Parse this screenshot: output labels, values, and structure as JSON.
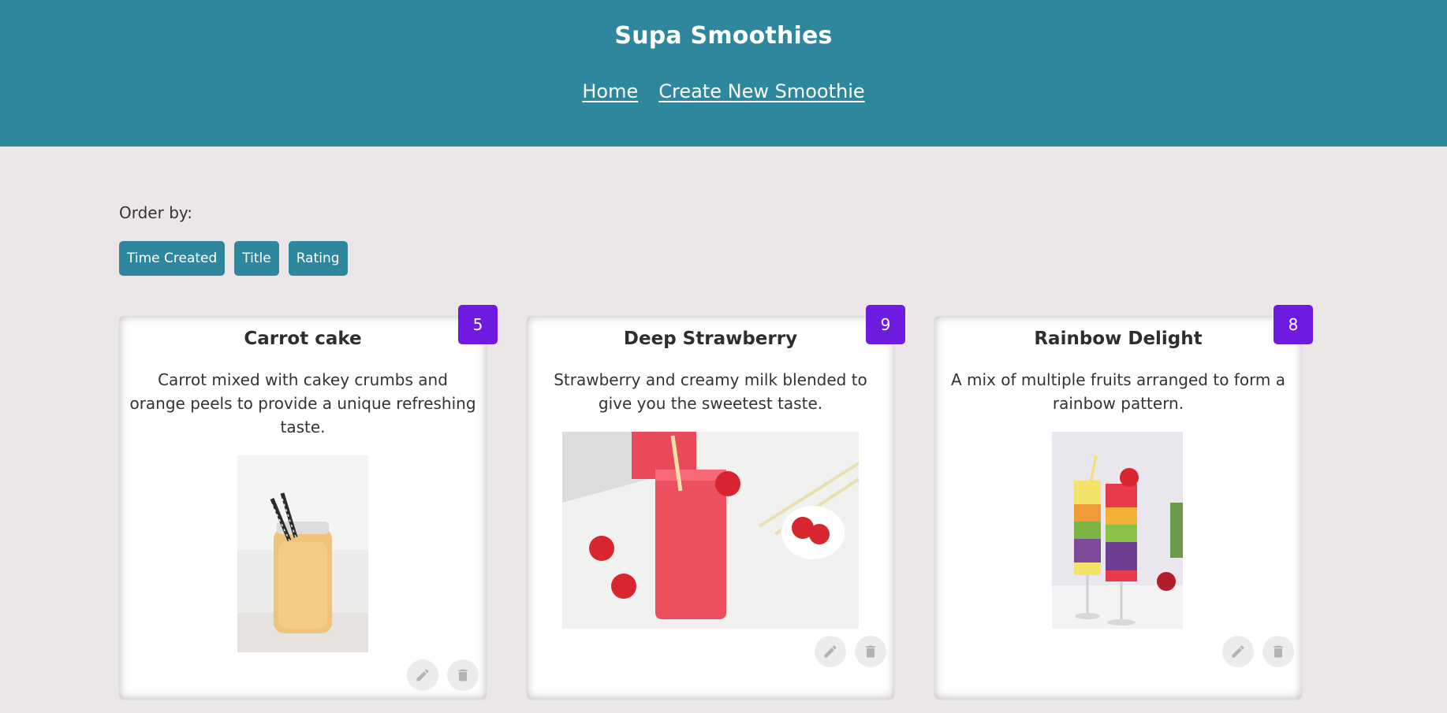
{
  "app": {
    "title": "Supa Smoothies"
  },
  "nav": {
    "items": [
      {
        "label": "Home"
      },
      {
        "label": "Create New Smoothie"
      }
    ]
  },
  "order": {
    "label": "Order by:",
    "buttons": [
      {
        "label": "Time Created"
      },
      {
        "label": "Title"
      },
      {
        "label": "Rating"
      }
    ]
  },
  "smoothies": [
    {
      "title": "Carrot cake",
      "description": "Carrot mixed with cakey crumbs and orange peels to provide a unique refreshing taste.",
      "rating": "5",
      "image": "carrot-smoothie-jar-photo"
    },
    {
      "title": "Deep Strawberry",
      "description": "Strawberry and creamy milk blended to give you the sweetest taste.",
      "rating": "9",
      "image": "strawberry-smoothie-glasses-photo"
    },
    {
      "title": "Rainbow Delight",
      "description": "A mix of multiple fruits arranged to form a rainbow pattern.",
      "rating": "8",
      "image": "rainbow-layered-smoothie-photo"
    }
  ],
  "icons": {
    "edit": "pencil-icon",
    "delete": "trash-icon"
  },
  "colors": {
    "header": "#2e879d",
    "background": "#ebe7e7",
    "button": "#2e879d",
    "rating_badge": "#6e1adf",
    "card": "#ffffff"
  }
}
